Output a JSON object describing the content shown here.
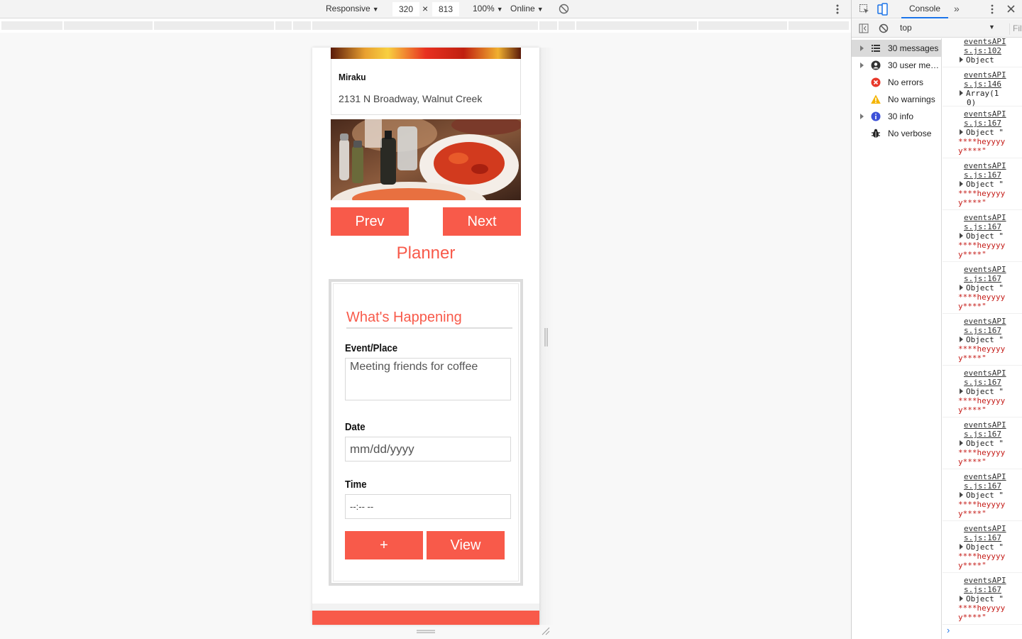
{
  "device_toolbar": {
    "device_mode": "Responsive",
    "width": "320",
    "times": "×",
    "height": "813",
    "zoom": "100%",
    "network": "Online"
  },
  "page": {
    "restaurant": {
      "name": "Miraku",
      "address": "2131 N Broadway, Walnut Creek"
    },
    "prev_label": "Prev",
    "next_label": "Next",
    "planner_title": "Planner",
    "form": {
      "heading": "What's Happening",
      "event_label": "Event/Place",
      "event_value": "Meeting friends for coffee",
      "date_label": "Date",
      "date_value": "mm/dd/yyyy",
      "time_label": "Time",
      "time_value": "--:-- --",
      "add_label": "+",
      "view_label": "View"
    },
    "accent_color": "#f85a4a"
  },
  "devtools": {
    "active_tab": "Console",
    "context": "top",
    "filter_placeholder": "Filt",
    "sidebar": [
      {
        "label": "30 messages",
        "icon": "list-icon",
        "expandable": true,
        "selected": true
      },
      {
        "label": "30 user me…",
        "icon": "user-icon",
        "expandable": true,
        "selected": false
      },
      {
        "label": "No errors",
        "icon": "error-icon",
        "expandable": false,
        "selected": false
      },
      {
        "label": "No warnings",
        "icon": "warning-icon",
        "expandable": false,
        "selected": false
      },
      {
        "label": "30 info",
        "icon": "info-icon",
        "expandable": true,
        "selected": false
      },
      {
        "label": "No verbose",
        "icon": "bug-icon",
        "expandable": false,
        "selected": false
      }
    ],
    "log": [
      {
        "src": "eventsAPI s.js:102",
        "line1": "Object",
        "line2": "",
        "line3": ""
      },
      {
        "src": "eventsAPI s.js:146",
        "line1": "Array(1",
        "line2": "0)",
        "line3": ""
      },
      {
        "src": "eventsAPI s.js:167",
        "line1": "Object \"",
        "line2": "****heyyyy",
        "line3": "y****\""
      },
      {
        "src": "eventsAPI s.js:167",
        "line1": "Object \"",
        "line2": "****heyyyy",
        "line3": "y****\""
      },
      {
        "src": "eventsAPI s.js:167",
        "line1": "Object \"",
        "line2": "****heyyyy",
        "line3": "y****\""
      },
      {
        "src": "eventsAPI s.js:167",
        "line1": "Object \"",
        "line2": "****heyyyy",
        "line3": "y****\""
      },
      {
        "src": "eventsAPI s.js:167",
        "line1": "Object \"",
        "line2": "****heyyyy",
        "line3": "y****\""
      },
      {
        "src": "eventsAPI s.js:167",
        "line1": "Object \"",
        "line2": "****heyyyy",
        "line3": "y****\""
      },
      {
        "src": "eventsAPI s.js:167",
        "line1": "Object \"",
        "line2": "****heyyyy",
        "line3": "y****\""
      },
      {
        "src": "eventsAPI s.js:167",
        "line1": "Object \"",
        "line2": "****heyyyy",
        "line3": "y****\""
      },
      {
        "src": "eventsAPI s.js:167",
        "line1": "Object \"",
        "line2": "****heyyyy",
        "line3": "y****\""
      },
      {
        "src": "eventsAPI s.js:167",
        "line1": "Object \"",
        "line2": "****heyyyy",
        "line3": "y****\""
      }
    ],
    "prompt": "›"
  }
}
